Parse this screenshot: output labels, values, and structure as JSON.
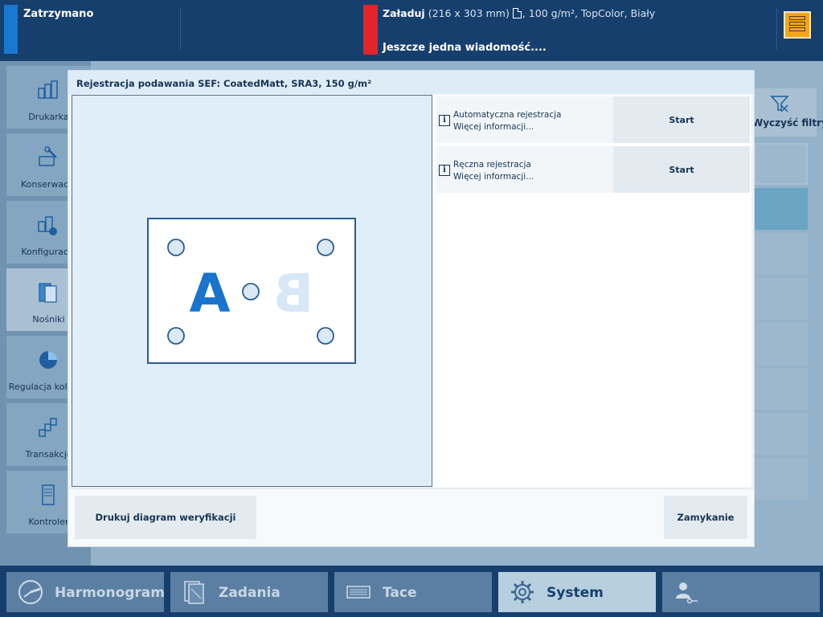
{
  "topbar": {
    "status": "Zatrzymano",
    "load_action": "Załaduj",
    "load_size": "(216 x 303 mm)",
    "load_details": ", 100 g/m², TopColor, Biały",
    "message": "Jeszcze jedna wiadomość....",
    "server_icon": "server-stack-icon",
    "status_color": "#1a78d0",
    "alert_color": "#e3242b"
  },
  "sidebar": {
    "items": [
      {
        "label": "Drukarka",
        "icon": "printer-icon"
      },
      {
        "label": "Konserwacja",
        "icon": "maintenance-icon"
      },
      {
        "label": "Konfiguracja",
        "icon": "configuration-icon"
      },
      {
        "label": "Nośniki",
        "icon": "media-icon"
      },
      {
        "label": "Regulacja kolorów",
        "icon": "color-calibration-icon"
      },
      {
        "label": "Transakcje",
        "icon": "transactions-icon"
      },
      {
        "label": "Kontroler",
        "icon": "controller-icon"
      }
    ]
  },
  "background": {
    "clear_filters": "Wyczyść filtry"
  },
  "modal": {
    "title": "Rejestracja podawania SEF: CoatedMatt, SRA3, 150 g/m²",
    "diagram": {
      "letter_front": "A",
      "letter_back": "B"
    },
    "options": [
      {
        "title": "Automatyczna rejestracja",
        "more": "Więcej informacji...",
        "button": "Start"
      },
      {
        "title": "Ręczna rejestracja",
        "more": "Więcej informacji...",
        "button": "Start"
      }
    ],
    "print_button": "Drukuj diagram weryfikacji",
    "close_button": "Zamykanie"
  },
  "bottom_nav": {
    "items": [
      {
        "label": "Harmonogram",
        "icon": "clock-icon"
      },
      {
        "label": "Zadania",
        "icon": "jobs-icon"
      },
      {
        "label": "Tace",
        "icon": "trays-icon"
      },
      {
        "label": "System",
        "icon": "gear-icon"
      },
      {
        "label": "",
        "icon": "user-key-icon"
      }
    ]
  }
}
